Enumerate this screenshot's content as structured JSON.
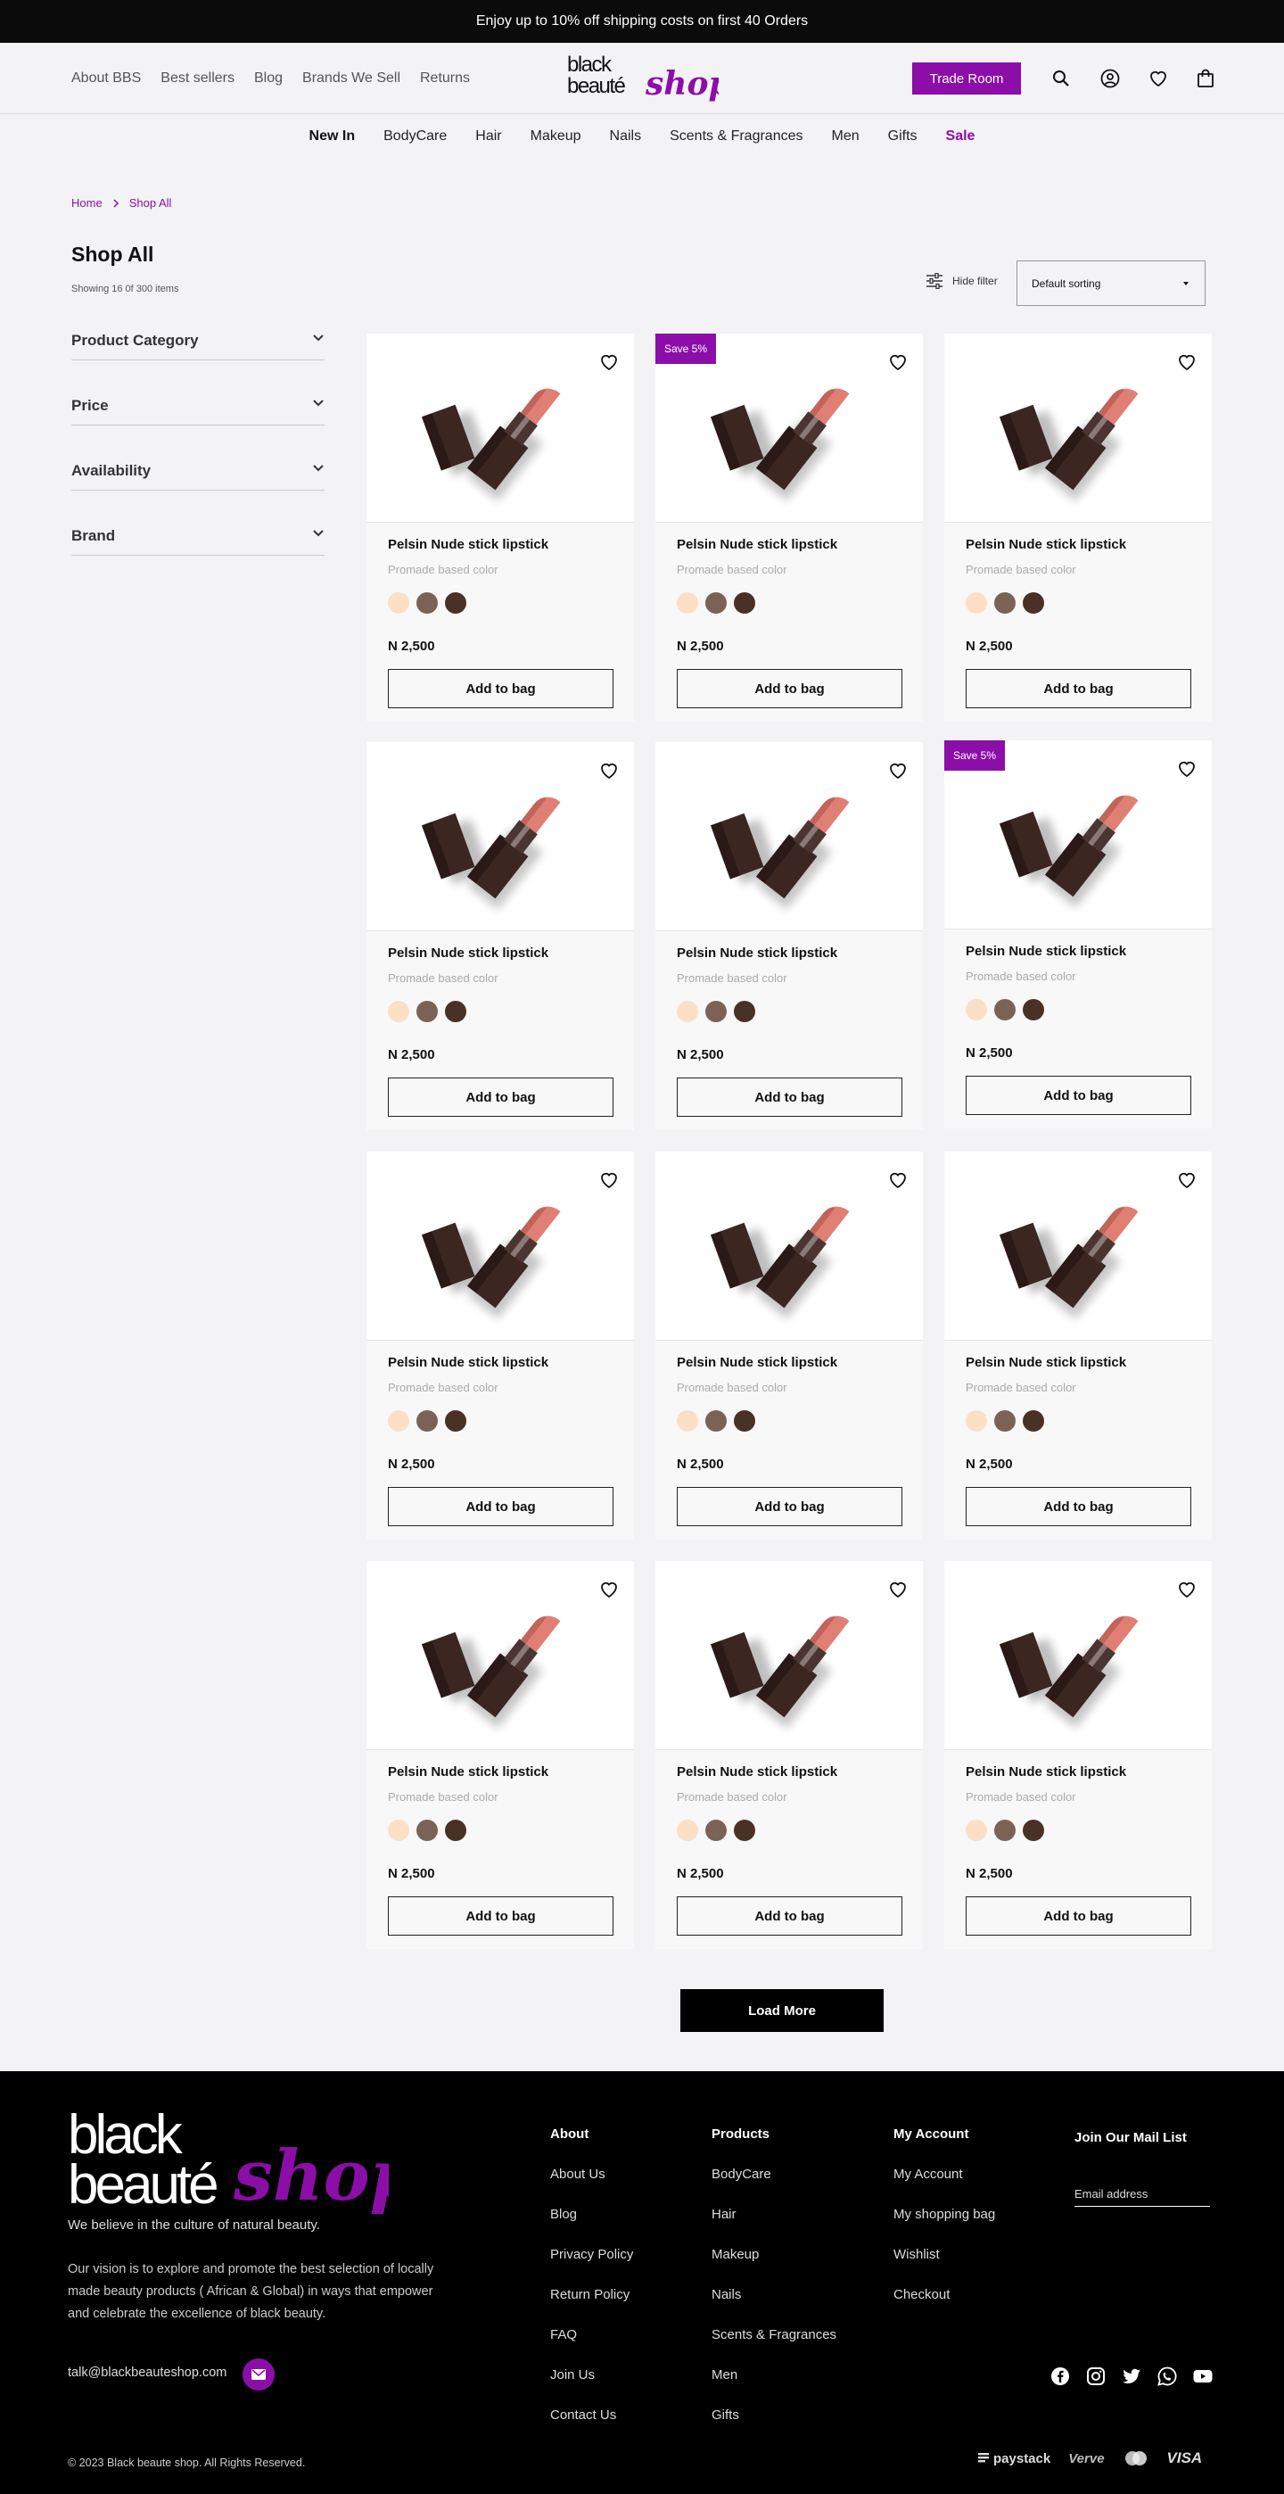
{
  "promo": "Enjoy up to 10% off shipping costs on first 40 Orders",
  "header": {
    "left_nav": [
      "About BBS",
      "Best sellers",
      "Blog",
      "Brands We Sell",
      "Returns"
    ],
    "logo_main": "black beauté",
    "logo_script": "shop",
    "trade_room": "Trade Room"
  },
  "main_nav": [
    "New In",
    "BodyCare",
    "Hair",
    "Makeup",
    "Nails",
    "Scents & Fragrances",
    "Men",
    "Gifts",
    "Sale"
  ],
  "breadcrumb": [
    "Home",
    "Shop All"
  ],
  "page": {
    "title": "Shop All",
    "showing": "Showing 16 0f 300 items",
    "hide_filter": "Hide filter",
    "sort_value": "Default sorting"
  },
  "filters": [
    "Product Category",
    "Price",
    "Availability",
    "Brand"
  ],
  "product": {
    "name": "Pelsin Nude stick lipstick",
    "sub": "Promade based color",
    "price": "N 2,500",
    "add_label": "Add to bag",
    "badge": "Save 5%",
    "swatch_colors": [
      "#fbe0c6",
      "#7a6356",
      "#4a3126"
    ]
  },
  "products_badged": [
    false,
    true,
    false,
    false,
    false,
    true,
    false,
    false,
    false,
    false,
    false,
    false
  ],
  "load_more": "Load More",
  "footer": {
    "tagline": "We believe in the culture of natural beauty.",
    "vision": "Our vision is to explore and promote the best selection of locally made beauty products ( African & Global) in ways that empower and celebrate the excellence of black beauty.",
    "email": "talk@blackbeauteshop.com",
    "columns": [
      {
        "title": "About",
        "links": [
          "About Us",
          "Blog",
          "Privacy Policy",
          "Return Policy",
          "FAQ",
          "Join Us",
          "Contact Us"
        ]
      },
      {
        "title": "Products",
        "links": [
          "BodyCare",
          "Hair",
          "Makeup",
          "Nails",
          "Scents & Fragrances",
          "Men",
          "Gifts"
        ]
      },
      {
        "title": "My Account",
        "links": [
          "My Account",
          "My shopping bag",
          "Wishlist",
          "Checkout"
        ]
      }
    ],
    "mail_list_title": "Join Our Mail List",
    "mail_placeholder": "Email address",
    "copyright": "© 2023 Black beaute shop. All Rights Reserved.",
    "payments": [
      "paystack",
      "Verve",
      "VISA"
    ]
  },
  "colors": {
    "accent": "#8b0ea8"
  }
}
